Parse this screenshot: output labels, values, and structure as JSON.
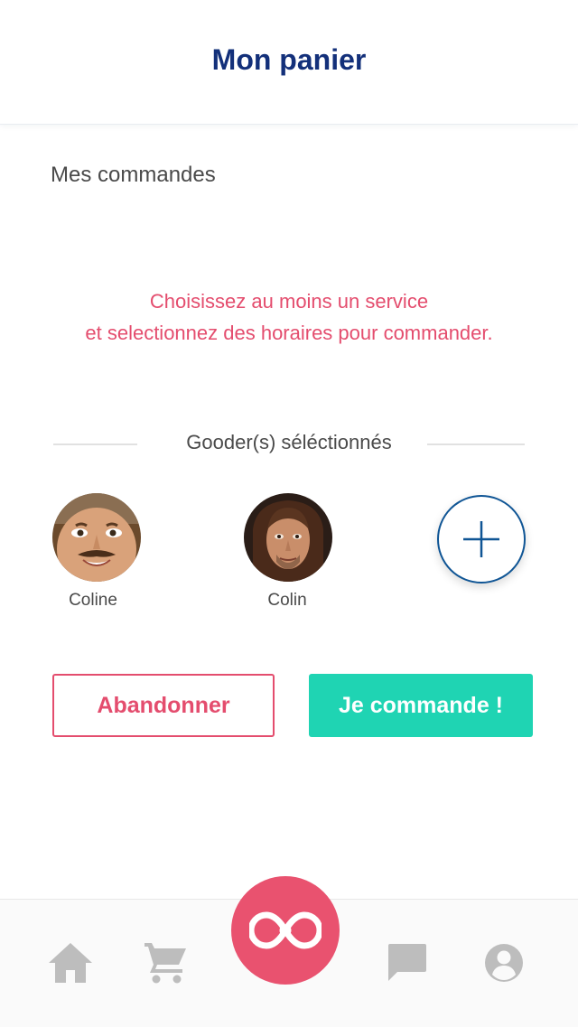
{
  "header": {
    "title": "Mon panier"
  },
  "orders": {
    "section_title": "Mes commandes",
    "empty_line_1": "Choisissez au moins un service",
    "empty_line_2": "et selectionnez des horaires pour commander."
  },
  "gooders": {
    "label": "Gooder(s) séléctionnés",
    "items": [
      {
        "name": "Coline"
      },
      {
        "name": "Colin"
      }
    ]
  },
  "actions": {
    "abandon_label": "Abandonner",
    "order_label": "Je commande !"
  },
  "colors": {
    "title": "#13307a",
    "alert": "#e44d6e",
    "primary_action": "#1fd4b3",
    "accent": "#e9526f",
    "add_button": "#0f5595",
    "tab_icon": "#bdbdbd"
  },
  "icons": {
    "add_gooder": "plus-icon",
    "center": "infinity-logo-icon",
    "tabs": [
      "home-icon",
      "cart-icon",
      "message-icon",
      "profile-icon"
    ]
  }
}
